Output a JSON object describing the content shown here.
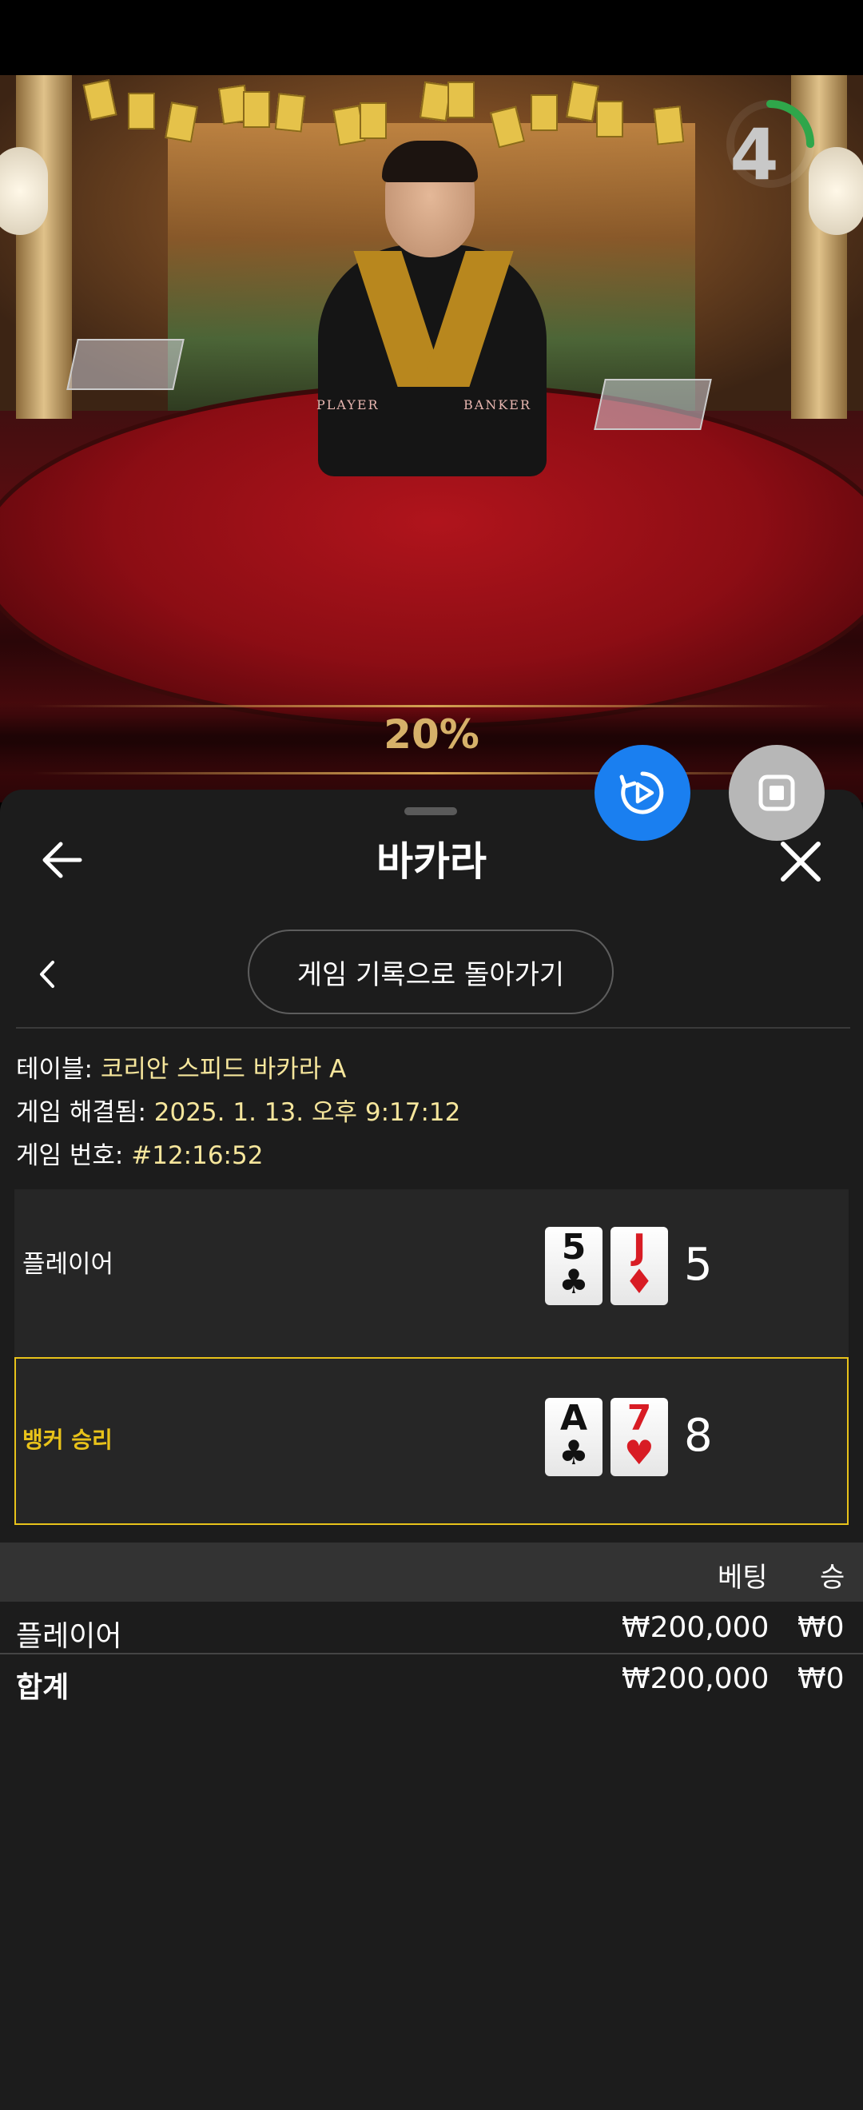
{
  "video": {
    "countdown": "4",
    "countdown_fraction": 0.25,
    "table_labels": {
      "player": "PLAYER",
      "banker": "BANKER"
    },
    "percent": "20%"
  },
  "header": {
    "title": "바카라"
  },
  "history_button": "게임 기록으로 돌아가기",
  "info": {
    "table_label": "테이블:",
    "table_value": "코리안 스피드 바카라 A",
    "resolved_label": "게임 해결됨:",
    "resolved_value": "2025. 1. 13. 오후 9:17:12",
    "round_label": "게임 번호:",
    "round_value": "#12:16:52"
  },
  "result": {
    "player": {
      "label": "플레이어",
      "label_color": "#ffffff",
      "cards": [
        {
          "rank": "5",
          "suit": "♣",
          "color": "black"
        },
        {
          "rank": "J",
          "suit": "♦",
          "color": "red"
        }
      ],
      "score": "5"
    },
    "banker": {
      "label": "뱅커 승리",
      "label_color": "#e8c21a",
      "cards": [
        {
          "rank": "A",
          "suit": "♣",
          "color": "black"
        },
        {
          "rank": "7",
          "suit": "♥",
          "color": "red"
        }
      ],
      "score": "8",
      "winner": true
    }
  },
  "bets_table": {
    "columns": [
      "베팅",
      "승"
    ],
    "rows": [
      {
        "label": "플레이어",
        "bet": "₩200,000",
        "win": "₩0"
      }
    ],
    "total": {
      "label": "합계",
      "bet": "₩200,000",
      "win": "₩0"
    }
  },
  "colors": {
    "accent_blue": "#1a7ff0",
    "winner_gold": "#e8c21a",
    "value_yellow": "#f6e69c"
  }
}
